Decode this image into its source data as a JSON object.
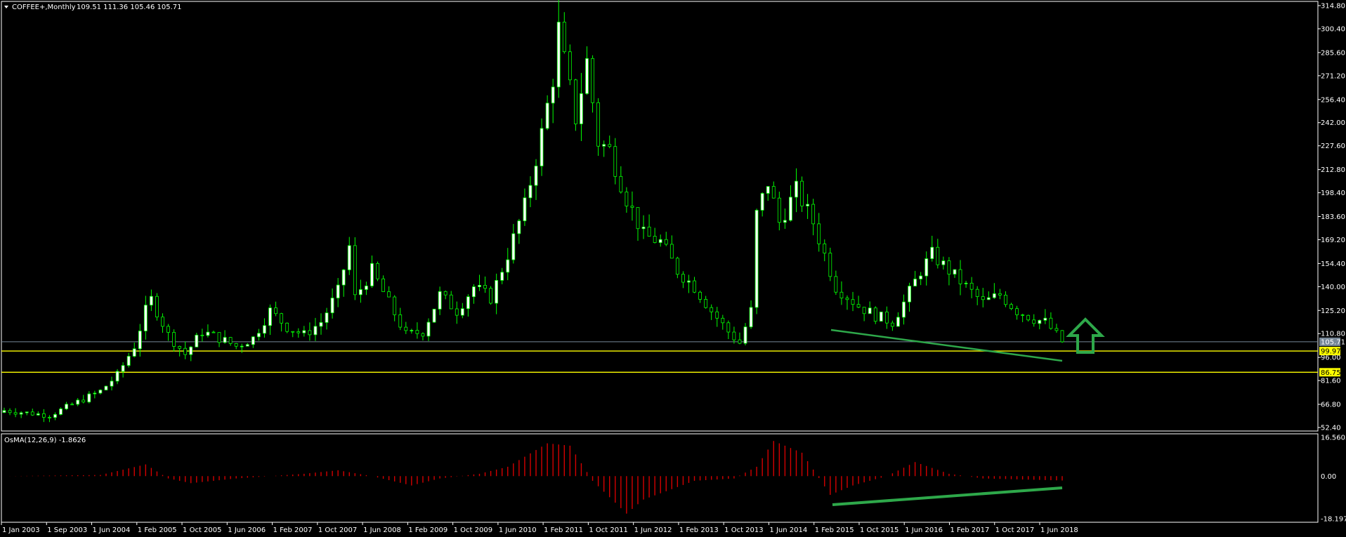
{
  "header": {
    "symbol_label": "COFFEE+,Monthly",
    "ohlc_text": "109.51 111.36 105.46 105.71"
  },
  "indicator": {
    "label": "OsMA(12,26,9) -1.8626"
  },
  "colors": {
    "background": "#000000",
    "frame": "#ffffff",
    "bull": "#ffffff",
    "bear": "#000000",
    "wick": "#00ff00",
    "level": "#ffff00",
    "trend": "#2ea84a",
    "osma": "#d40000",
    "axis_text": "#ffffff",
    "bid_line": "#778899"
  },
  "price_axis": {
    "ticks": [
      "314.80",
      "300.40",
      "285.60",
      "271.20",
      "256.40",
      "242.00",
      "227.60",
      "212.80",
      "198.40",
      "183.60",
      "169.20",
      "154.40",
      "140.00",
      "125.20",
      "110.80",
      "96.00",
      "81.60",
      "66.80",
      "52.40"
    ]
  },
  "price_tags": [
    {
      "label": "105.71",
      "value": 105.71,
      "kind": "bid"
    },
    {
      "label": "99.97",
      "value": 99.97,
      "kind": "level"
    },
    {
      "label": "86.75",
      "value": 86.75,
      "kind": "level"
    }
  ],
  "indicator_axis": {
    "ticks": [
      "16.5603",
      "0.00",
      "-18.1973"
    ]
  },
  "time_axis": {
    "ticks": [
      "1 Jan 2003",
      "1 Sep 2003",
      "1 Jun 2004",
      "1 Feb 2005",
      "1 Oct 2005",
      "1 Jun 2006",
      "1 Feb 2007",
      "1 Oct 2007",
      "1 Jun 2008",
      "1 Feb 2009",
      "1 Oct 2009",
      "1 Jun 2010",
      "1 Feb 2011",
      "1 Oct 2011",
      "1 Jun 2012",
      "1 Feb 2013",
      "1 Oct 2013",
      "1 Jun 2014",
      "1 Feb 2015",
      "1 Oct 2015",
      "1 Jun 2016",
      "1 Feb 2017",
      "1 Oct 2017",
      "1 Jun 2018"
    ]
  },
  "chart_data": {
    "type": "candlestick",
    "frequency": "monthly",
    "price_range": [
      52.4,
      314.8
    ],
    "indicator_range": [
      -18.1973,
      16.5603
    ],
    "close_series": [
      {
        "t": "2003-01",
        "c": 63
      },
      {
        "t": "2003-09",
        "c": 60
      },
      {
        "t": "2004-06",
        "c": 75
      },
      {
        "t": "2004-09",
        "c": 85
      },
      {
        "t": "2004-12",
        "c": 103
      },
      {
        "t": "2005-02",
        "c": 125
      },
      {
        "t": "2005-03",
        "c": 132
      },
      {
        "t": "2005-06",
        "c": 110
      },
      {
        "t": "2005-09",
        "c": 98
      },
      {
        "t": "2005-12",
        "c": 112
      },
      {
        "t": "2006-03",
        "c": 108
      },
      {
        "t": "2006-06",
        "c": 103
      },
      {
        "t": "2006-09",
        "c": 108
      },
      {
        "t": "2006-12",
        "c": 125
      },
      {
        "t": "2007-03",
        "c": 115
      },
      {
        "t": "2007-06",
        "c": 110
      },
      {
        "t": "2007-09",
        "c": 118
      },
      {
        "t": "2007-12",
        "c": 137
      },
      {
        "t": "2008-02",
        "c": 165
      },
      {
        "t": "2008-03",
        "c": 133
      },
      {
        "t": "2008-06",
        "c": 150
      },
      {
        "t": "2008-09",
        "c": 130
      },
      {
        "t": "2008-12",
        "c": 110
      },
      {
        "t": "2009-03",
        "c": 112
      },
      {
        "t": "2009-06",
        "c": 135
      },
      {
        "t": "2009-09",
        "c": 125
      },
      {
        "t": "2009-12",
        "c": 140
      },
      {
        "t": "2010-03",
        "c": 133
      },
      {
        "t": "2010-06",
        "c": 160
      },
      {
        "t": "2010-09",
        "c": 190
      },
      {
        "t": "2010-12",
        "c": 235
      },
      {
        "t": "2011-02",
        "c": 270
      },
      {
        "t": "2011-03",
        "c": 300
      },
      {
        "t": "2011-04",
        "c": 280
      },
      {
        "t": "2011-06",
        "c": 245
      },
      {
        "t": "2011-08",
        "c": 280
      },
      {
        "t": "2011-10",
        "c": 230
      },
      {
        "t": "2011-12",
        "c": 225
      },
      {
        "t": "2012-03",
        "c": 195
      },
      {
        "t": "2012-06",
        "c": 172
      },
      {
        "t": "2012-09",
        "c": 168
      },
      {
        "t": "2012-12",
        "c": 150
      },
      {
        "t": "2013-03",
        "c": 140
      },
      {
        "t": "2013-06",
        "c": 125
      },
      {
        "t": "2013-09",
        "c": 112
      },
      {
        "t": "2013-11",
        "c": 105
      },
      {
        "t": "2014-01",
        "c": 125
      },
      {
        "t": "2014-02",
        "c": 185
      },
      {
        "t": "2014-04",
        "c": 205
      },
      {
        "t": "2014-06",
        "c": 180
      },
      {
        "t": "2014-09",
        "c": 200
      },
      {
        "t": "2014-12",
        "c": 180
      },
      {
        "t": "2015-02",
        "c": 160
      },
      {
        "t": "2015-04",
        "c": 140
      },
      {
        "t": "2015-08",
        "c": 128
      },
      {
        "t": "2015-11",
        "c": 122
      },
      {
        "t": "2016-02",
        "c": 118
      },
      {
        "t": "2016-04",
        "c": 130
      },
      {
        "t": "2016-07",
        "c": 150
      },
      {
        "t": "2016-09",
        "c": 160
      },
      {
        "t": "2016-12",
        "c": 150
      },
      {
        "t": "2017-03",
        "c": 140
      },
      {
        "t": "2017-06",
        "c": 130
      },
      {
        "t": "2017-09",
        "c": 135
      },
      {
        "t": "2017-12",
        "c": 125
      },
      {
        "t": "2018-03",
        "c": 120
      },
      {
        "t": "2018-05",
        "c": 118
      },
      {
        "t": "2018-07",
        "c": 110
      },
      {
        "t": "2018-08",
        "c": 105.71
      }
    ],
    "osma_series": [
      {
        "t": "2003-01",
        "v": 0
      },
      {
        "t": "2004-06",
        "v": 0.5
      },
      {
        "t": "2005-02",
        "v": 5
      },
      {
        "t": "2005-06",
        "v": -1
      },
      {
        "t": "2005-10",
        "v": -3
      },
      {
        "t": "2006-06",
        "v": -1
      },
      {
        "t": "2007-06",
        "v": 1
      },
      {
        "t": "2007-12",
        "v": 2.5
      },
      {
        "t": "2008-06",
        "v": 0
      },
      {
        "t": "2009-01",
        "v": -4
      },
      {
        "t": "2009-06",
        "v": -1
      },
      {
        "t": "2010-01",
        "v": 1
      },
      {
        "t": "2010-06",
        "v": 4
      },
      {
        "t": "2011-01",
        "v": 14
      },
      {
        "t": "2011-05",
        "v": 13
      },
      {
        "t": "2011-09",
        "v": -2
      },
      {
        "t": "2012-03",
        "v": -16
      },
      {
        "t": "2012-06",
        "v": -10
      },
      {
        "t": "2013-03",
        "v": -2
      },
      {
        "t": "2013-10",
        "v": -1
      },
      {
        "t": "2014-02",
        "v": 4
      },
      {
        "t": "2014-05",
        "v": 15
      },
      {
        "t": "2014-10",
        "v": 10
      },
      {
        "t": "2015-03",
        "v": -8
      },
      {
        "t": "2015-07",
        "v": -4
      },
      {
        "t": "2016-01",
        "v": 0
      },
      {
        "t": "2016-06",
        "v": 6
      },
      {
        "t": "2016-12",
        "v": 1
      },
      {
        "t": "2017-06",
        "v": -1
      },
      {
        "t": "2018-08",
        "v": -1.8626
      }
    ]
  }
}
